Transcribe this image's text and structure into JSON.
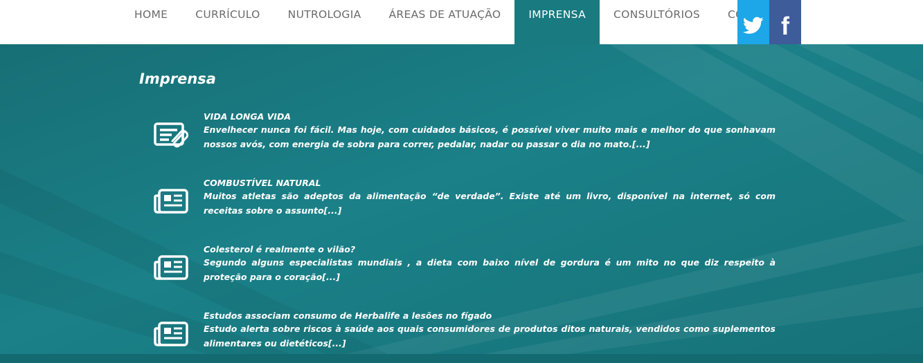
{
  "nav": {
    "items": [
      {
        "label": "HOME"
      },
      {
        "label": "CURRÍCULO"
      },
      {
        "label": "NUTROLOGIA"
      },
      {
        "label": "ÁREAS DE ATUAÇÃO"
      },
      {
        "label": "IMPRENSA",
        "active": true
      },
      {
        "label": "CONSULTÓRIOS"
      },
      {
        "label": "CONTATO"
      }
    ]
  },
  "social": {
    "twitter_icon": "twitter-bird-icon",
    "facebook_icon": "facebook-f-icon",
    "facebook_glyph": "f"
  },
  "page": {
    "title": "Imprensa"
  },
  "articles": [
    {
      "icon": "notes-attachment-icon",
      "title": "VIDA LONGA VIDA",
      "summary": "Envelhecer nunca foi fácil. Mas hoje, com cuidados básicos, é possível viver muito mais e melhor do que sonhavam nossos avós, com energia de sobra para correr, pedalar, nadar ou passar o dia no mato.",
      "more": "[...]"
    },
    {
      "icon": "newspaper-icon",
      "title": "COMBUSTÍVEL NATURAL",
      "summary": "Muitos atletas são adeptos da alimentação “de verdade”. Existe até um livro, disponível na internet, só com receitas sobre o assunto",
      "more": "[...]"
    },
    {
      "icon": "newspaper-icon",
      "title": "Colesterol é realmente o vilão?",
      "summary": "Segundo alguns especialistas mundiais , a dieta com baixo nível de gordura é um mito no que diz respeito à proteção para o coração",
      "more": "[...]"
    },
    {
      "icon": "newspaper-icon",
      "title": "Estudos associam consumo de Herbalife a lesões no fígado",
      "summary": "Estudo alerta sobre riscos à saúde aos quais consumidores de produtos ditos naturais, vendidos como suplementos alimentares ou dietéticos",
      "more": "[...]"
    }
  ],
  "colors": {
    "teal": "#1a7a80",
    "active_tab": "#197a80",
    "twitter": "#1da6e8",
    "facebook": "#3e5b9a",
    "nav_text": "#6b6b6b"
  }
}
